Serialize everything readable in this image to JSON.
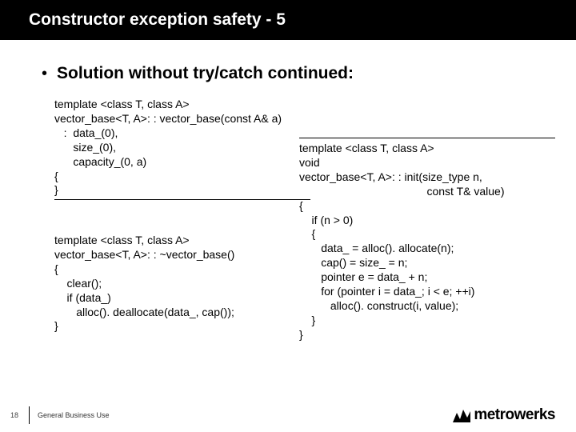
{
  "title": "Constructor exception safety - 5",
  "bullet": "Solution without try/catch continued:",
  "code": {
    "ctor": "template <class T, class A>\nvector_base<T, A>: : vector_base(const A& a)\n   :  data_(0),\n      size_(0),\n      capacity_(0, a)\n{\n}",
    "dtor": "template <class T, class A>\nvector_base<T, A>: : ~vector_base()\n{\n    clear();\n    if (data_)\n       alloc(). deallocate(data_, cap());\n}",
    "init": "template <class T, class A>\nvoid\nvector_base<T, A>: : init(size_type n,\n                                         const T& value)\n{\n    if (n > 0)\n    {\n       data_ = alloc(). allocate(n);\n       cap() = size_ = n;\n       pointer e = data_ + n;\n       for (pointer i = data_; i < e; ++i)\n          alloc(). construct(i, value);\n    }\n}"
  },
  "footer": {
    "page": "18",
    "label": "General Business Use"
  },
  "brand": {
    "name": "metrowerks"
  }
}
